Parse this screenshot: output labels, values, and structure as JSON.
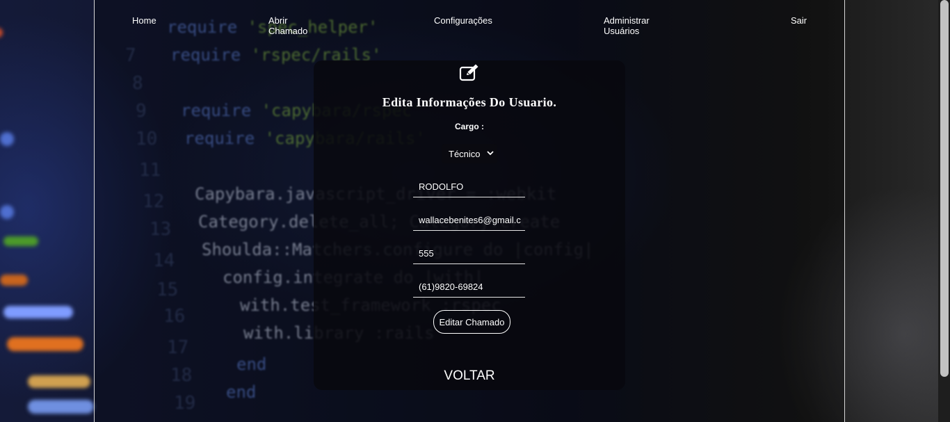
{
  "nav": {
    "home": "Home",
    "abrir_chamado": "Abrir Chamado",
    "configuracoes": "Configurações",
    "administrar_usuarios": "Administrar Usuários",
    "sair": "Sair"
  },
  "form": {
    "icon": "edit-icon",
    "title": "Edita Informações Do Usuario.",
    "cargo_label": "Cargo :",
    "cargo_selected": "Técnico",
    "name_value": "RODOLFO",
    "email_value": "wallacebenites6@gmail.c",
    "matricula_value": "555",
    "phone_value": "(61)9820-69824",
    "submit_label": "Editar Chamado",
    "back_label": "VOLTAR"
  }
}
